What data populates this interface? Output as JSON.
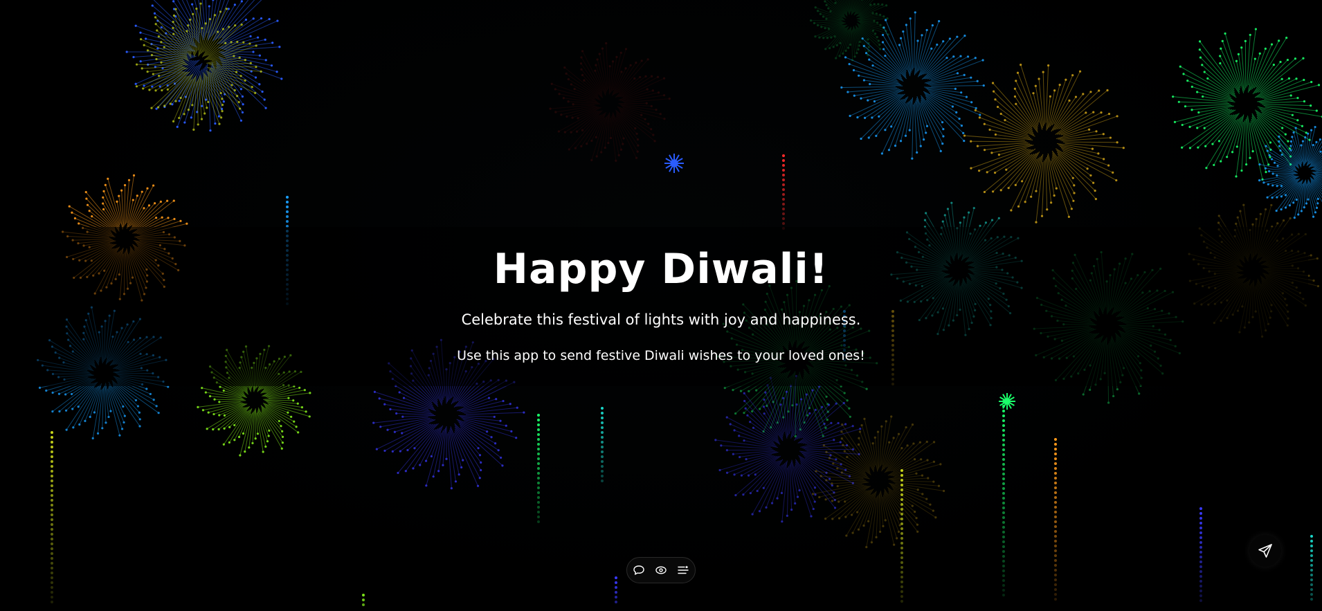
{
  "hero": {
    "title": "Happy Diwali!",
    "tagline": "Celebrate this festival of lights with joy and happiness.",
    "subtitle": "Use this app to send festive Diwali wishes to your loved ones!"
  },
  "toolbar": {
    "items": [
      {
        "icon": "chat-bubble-icon"
      },
      {
        "icon": "eye-icon"
      },
      {
        "icon": "list-settings-icon"
      }
    ]
  },
  "send_button": {
    "icon": "send-paper-plane-icon"
  },
  "colors": {
    "background": "#000000",
    "text": "#ffffff",
    "burst_palette": [
      "#2a5cff",
      "#c8d61a",
      "#1aa0ff",
      "#ff9a1a",
      "#7be01a",
      "#3a3aff",
      "#1aff6a",
      "#1ad6c8",
      "#e0b01a",
      "#ff2a2a"
    ]
  }
}
